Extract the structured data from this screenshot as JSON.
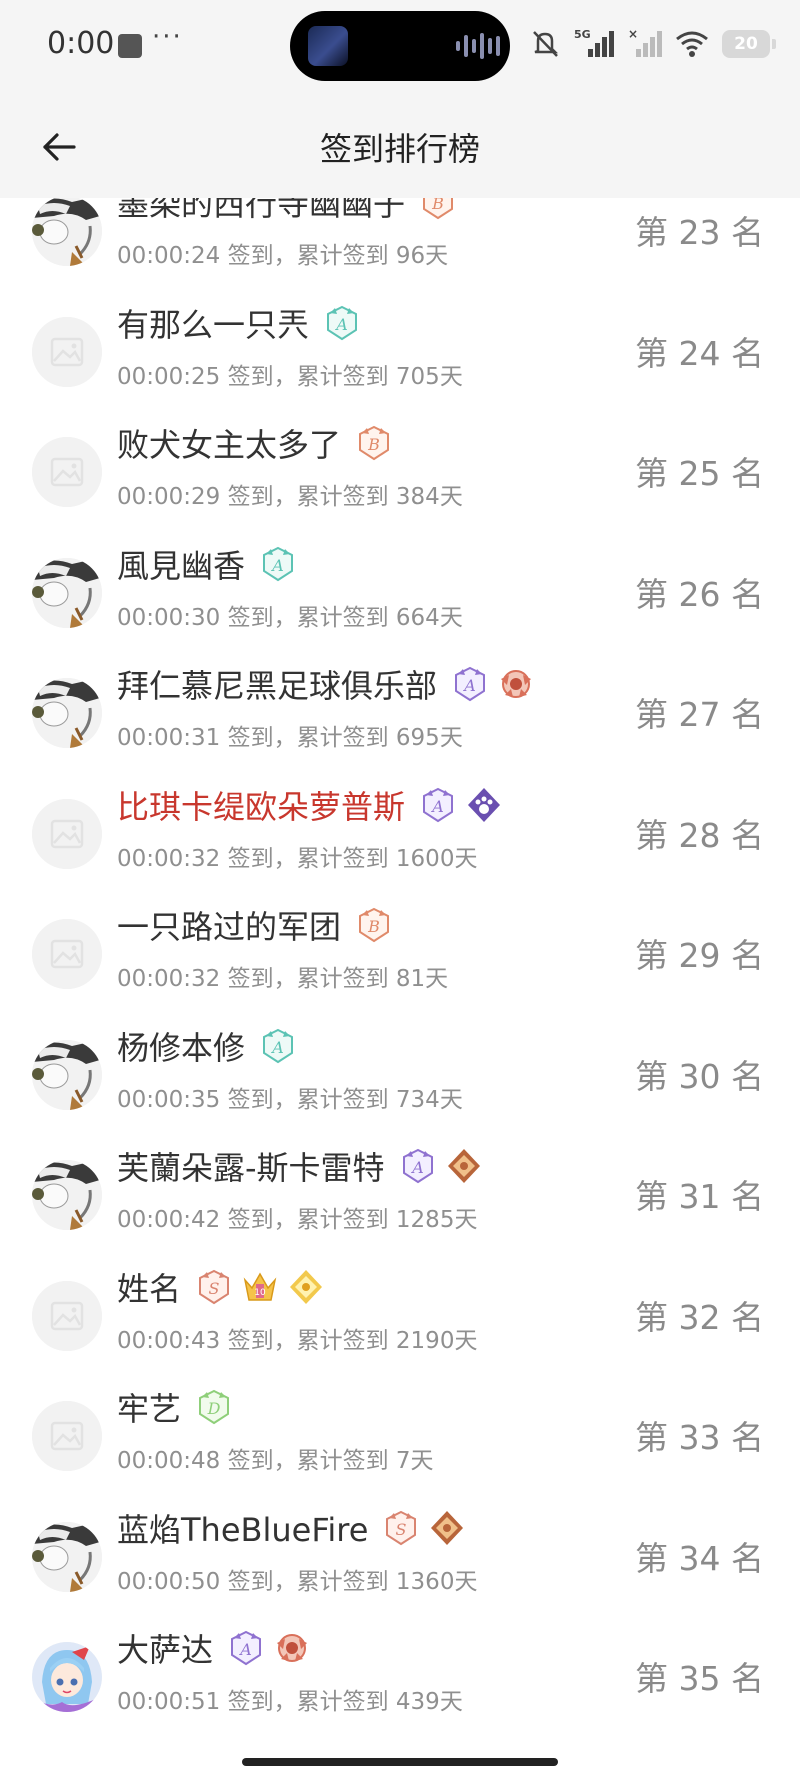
{
  "status_bar": {
    "time": "0:00",
    "more": "···",
    "battery": "20",
    "network": "5G"
  },
  "app_bar": {
    "title": "签到排行榜"
  },
  "entries": [
    {
      "name": "墨染的西行寺幽幽子",
      "meta": "00:00:24 签到，累计签到 96天",
      "rank": "第 23 名",
      "avatar": "maid-character",
      "highlight": false,
      "badges": [
        "badge-b-orange"
      ]
    },
    {
      "name": "有那么一只兲",
      "meta": "00:00:25 签到，累计签到 705天",
      "rank": "第 24 名",
      "avatar": "placeholder",
      "highlight": false,
      "badges": [
        "badge-a-teal"
      ]
    },
    {
      "name": "败犬女主太多了",
      "meta": "00:00:29 签到，累计签到 384天",
      "rank": "第 25 名",
      "avatar": "placeholder",
      "highlight": false,
      "badges": [
        "badge-b-orange"
      ]
    },
    {
      "name": "風見幽香",
      "meta": "00:00:30 签到，累计签到 664天",
      "rank": "第 26 名",
      "avatar": "maid-character",
      "highlight": false,
      "badges": [
        "badge-a-teal"
      ]
    },
    {
      "name": "拜仁慕尼黑足球俱乐部",
      "meta": "00:00:31 签到，累计签到 695天",
      "rank": "第 27 名",
      "avatar": "maid-character",
      "highlight": false,
      "badges": [
        "badge-a-purple",
        "badge-crest-red"
      ]
    },
    {
      "name": "比琪卡缇欧朵萝普斯",
      "meta": "00:00:32 签到，累计签到 1600天",
      "rank": "第 28 名",
      "avatar": "placeholder",
      "highlight": true,
      "badges": [
        "badge-a-purple",
        "badge-paw-purple"
      ]
    },
    {
      "name": "一只路过的军团",
      "meta": "00:00:32 签到，累计签到 81天",
      "rank": "第 29 名",
      "avatar": "placeholder",
      "highlight": false,
      "badges": [
        "badge-b-orange"
      ]
    },
    {
      "name": "杨修本修",
      "meta": "00:00:35 签到，累计签到 734天",
      "rank": "第 30 名",
      "avatar": "maid-character",
      "highlight": false,
      "badges": [
        "badge-a-teal"
      ]
    },
    {
      "name": "芙蘭朵露-斯卡雷特",
      "meta": "00:00:42 签到，累计签到 1285天",
      "rank": "第 31 名",
      "avatar": "maid-character",
      "highlight": false,
      "badges": [
        "badge-a-purple",
        "badge-gem-bronze"
      ]
    },
    {
      "name": "姓名",
      "meta": "00:00:43 签到，累计签到 2190天",
      "rank": "第 32 名",
      "avatar": "placeholder",
      "highlight": false,
      "badges": [
        "badge-s-orange",
        "badge-crown-gold",
        "badge-gem-gold"
      ]
    },
    {
      "name": "牢艺",
      "meta": "00:00:48 签到，累计签到 7天",
      "rank": "第 33 名",
      "avatar": "placeholder",
      "highlight": false,
      "badges": [
        "badge-d-green"
      ]
    },
    {
      "name": "蓝焰TheBlueFire",
      "meta": "00:00:50 签到，累计签到 1360天",
      "rank": "第 34 名",
      "avatar": "maid-character",
      "highlight": false,
      "badges": [
        "badge-s-orange",
        "badge-gem-bronze"
      ]
    },
    {
      "name": "大萨达",
      "meta": "00:00:51 签到，累计签到 439天",
      "rank": "第 35 名",
      "avatar": "anime-girl",
      "highlight": false,
      "badges": [
        "badge-a-purple",
        "badge-crest-red"
      ]
    }
  ],
  "colors": {
    "highlight_name": "#c8372d",
    "meta_text": "#8f8f8f",
    "rank_text": "#8a8a8a",
    "bar_bg": "#f5f5f5"
  }
}
